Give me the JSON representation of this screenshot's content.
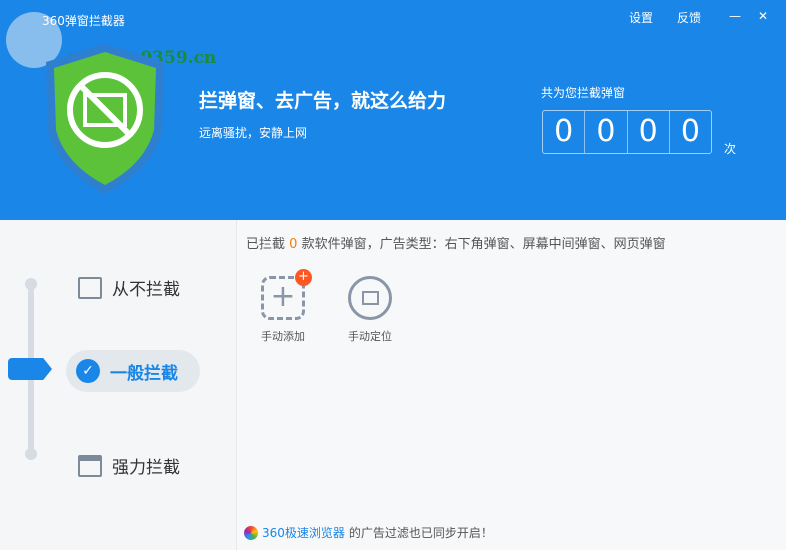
{
  "window": {
    "title": "360弹窗拦截器",
    "settings": "设置",
    "feedback": "反馈",
    "minimize": "—",
    "close": "✕",
    "watermark": "www.pc0359.cn"
  },
  "banner": {
    "headline": "拦弹窗、去广告，就这么给力",
    "subtitle": "远离骚扰，安静上网",
    "counter_label": "共为您拦截弹窗",
    "digits": [
      "0",
      "0",
      "0",
      "0"
    ],
    "unit": "次"
  },
  "modes": [
    {
      "label": "从不拦截"
    },
    {
      "label": "一般拦截",
      "active": true
    },
    {
      "label": "强力拦截"
    }
  ],
  "main": {
    "info_prefix": "已拦截",
    "count": "0",
    "info_suffix": "款软件弹窗，广告类型：右下角弹窗、屏幕中间弹窗、网页弹窗",
    "tools": [
      {
        "label": "手动添加"
      },
      {
        "label": "手动定位"
      }
    ]
  },
  "footer": {
    "link": "360极速浏览器",
    "text": "的广告过滤也已同步开启！"
  }
}
